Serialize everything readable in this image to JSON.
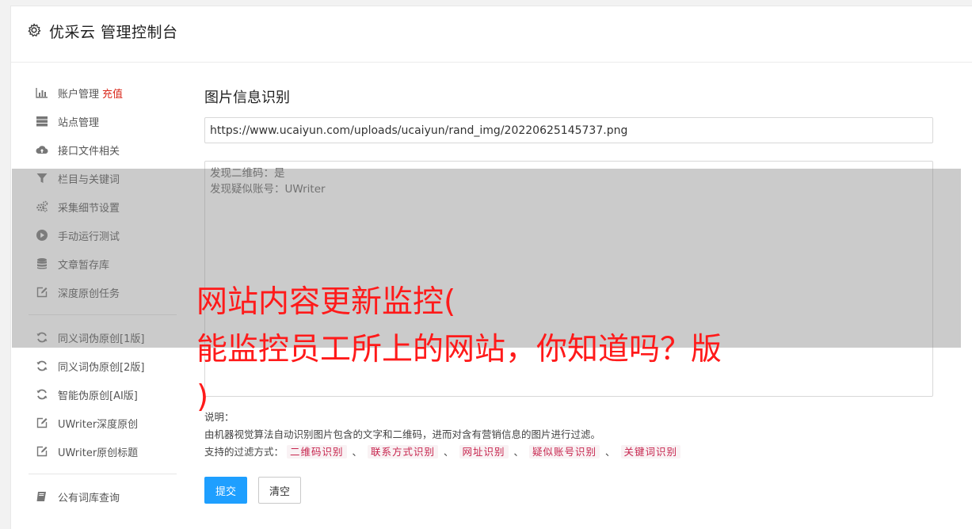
{
  "header": {
    "title": "优采云 管理控制台",
    "icon": "gear-icon"
  },
  "sidebar": {
    "items": [
      {
        "label": "账户管理",
        "extra": "充值",
        "icon": "bar-chart-icon"
      },
      {
        "label": "站点管理",
        "icon": "server-icon"
      },
      {
        "label": "接口文件相关",
        "icon": "cloud-upload-icon"
      },
      {
        "label": "栏目与关键词",
        "icon": "filter-icon"
      },
      {
        "label": "采集细节设置",
        "icon": "cogs-icon"
      },
      {
        "label": "手动运行测试",
        "icon": "play-circle-icon"
      },
      {
        "label": "文章暂存库",
        "icon": "database-icon"
      },
      {
        "label": "深度原创任务",
        "icon": "edit-icon"
      },
      {
        "label": "同义词伪原创[1版]",
        "icon": "refresh-icon"
      },
      {
        "label": "同义词伪原创[2版]",
        "icon": "refresh-icon"
      },
      {
        "label": "智能伪原创[AI版]",
        "icon": "refresh-icon"
      },
      {
        "label": "UWriter深度原创",
        "icon": "edit-icon"
      },
      {
        "label": "UWriter原创标题",
        "icon": "edit-icon"
      },
      {
        "label": "公有词库查询",
        "icon": "book-icon"
      }
    ]
  },
  "main": {
    "title": "图片信息识别",
    "url_value": "https://www.ucaiyun.com/uploads/ucaiyun/rand_img/20220625145737.png",
    "result_lines": [
      "发现二维码：是",
      "发现疑似账号：UWriter"
    ],
    "desc_label": "说明：",
    "desc_text": "由机器视觉算法自动识别图片包含的文字和二维码，进而对含有营销信息的图片进行过滤。",
    "filter_label": "支持的过滤方式：",
    "filter_tags": [
      "二维码识别",
      "联系方式识别",
      "网址识别",
      "疑似账号识别",
      "关键词识别"
    ],
    "tag_separator": "、",
    "submit_label": "提交",
    "clear_label": "清空"
  },
  "overlay": {
    "lines": [
      "网站内容更新监控(",
      "能监控员工所上的网站，你知道吗？版",
      ")"
    ]
  },
  "colors": {
    "accent": "#1e9fff",
    "tag": "#c7254e",
    "overlay_text": "#ff1a1a",
    "recharge": "#d9291c"
  }
}
